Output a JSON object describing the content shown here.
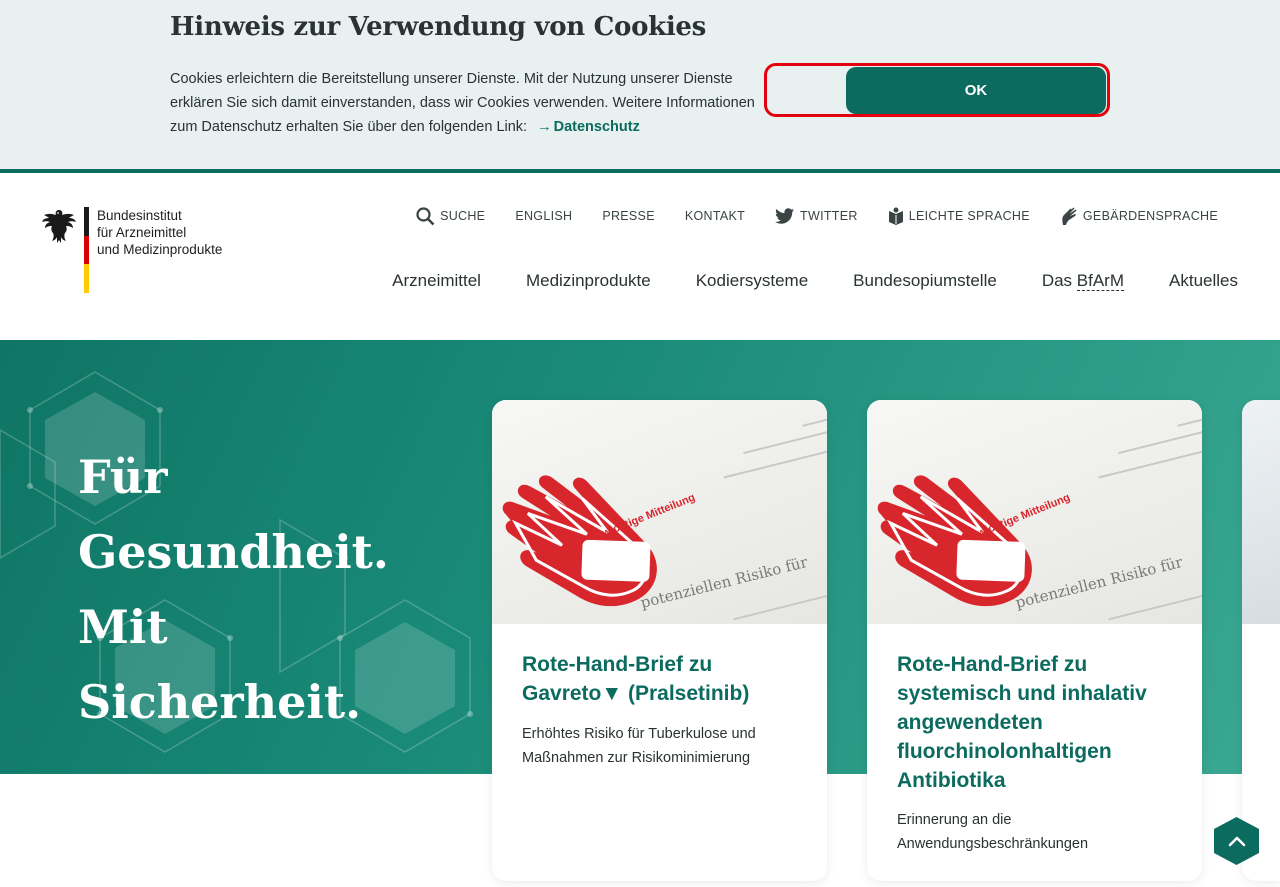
{
  "cookie": {
    "title": "Hinweis zur Verwendung von Cookies",
    "text": "Cookies erleichtern die Bereitstellung unserer Dienste. Mit der Nutzung unserer Dienste erklären Sie sich damit einverstanden, dass wir Cookies verwenden. Weitere Informationen zum Datenschutz erhalten Sie über den folgenden Link:",
    "link_label": "Datenschutz",
    "ok_label": "OK"
  },
  "logo": {
    "line1": "Bundesinstitut",
    "line2": "für Arzneimittel",
    "line3": "und Medizinprodukte"
  },
  "meta_nav": {
    "search": "SUCHE",
    "english": "ENGLISH",
    "presse": "PRESSE",
    "kontakt": "KONTAKT",
    "twitter": "TWITTER",
    "leichte_sprache": "LEICHTE SPRACHE",
    "gebaerdensprache": "GEBÄRDENSPRACHE"
  },
  "main_nav": {
    "arzneimittel": "Arzneimittel",
    "medizinprodukte": "Medizinprodukte",
    "kodiersysteme": "Kodiersysteme",
    "bundesopiumstelle": "Bundesopiumstelle",
    "das": "Das",
    "bfarm": "BfArM",
    "aktuelles": "Aktuelles"
  },
  "hero": {
    "line1": "Für",
    "line2": "Gesundheit.",
    "line3": "Mit",
    "line4": "Sicherheit."
  },
  "cards": [
    {
      "title": "Rote-Hand-Brief zu Gavreto▼ (Pralsetinib)",
      "subtitle": "Erhöhtes Risiko für Tuberkulose und Maßnahmen zur Risikominimierung",
      "stamp_text": "wichtige Mitteilung",
      "doc_text": "potenziellen Risiko für"
    },
    {
      "title": "Rote-Hand-Brief zu systemisch und inhalativ angewendeten fluorchinolonhaltigen Antibiotika",
      "subtitle": "Erinnerung an die Anwendungsbeschränkungen",
      "stamp_text": "wichtige Mitteilung",
      "doc_text": "potenziellen Risiko für"
    }
  ],
  "colors": {
    "primary": "#0b6b5f",
    "banner_bg": "#e8f1ef",
    "highlight_red": "#e3000f",
    "stamp_red": "#d7262c"
  }
}
